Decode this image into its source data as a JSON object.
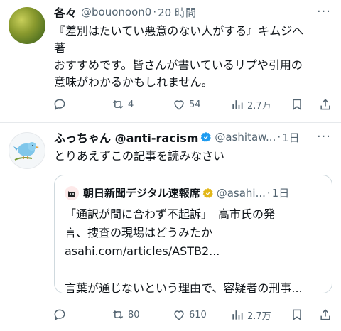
{
  "tweets": [
    {
      "name": "各々",
      "handle": "@bouonoon0",
      "dot": "·",
      "time": "20 時間",
      "body_lines": [
        "『差別はたいてい悪意のない人がする』キムジヘ",
        "著",
        "おすすめです。皆さんが書いているリプや引用の",
        "意味がわかるかもしれません。"
      ],
      "retweets": "4",
      "likes": "54",
      "views": "2.7万"
    },
    {
      "name": "ふっちゃん @anti-racism",
      "handle": "@ashitaw...",
      "dot": "·",
      "time": "1日",
      "body_lines": [
        "とりあえずこの記事を読みなさい"
      ],
      "quote": {
        "name": "朝日新聞デジタル速報席",
        "handle": "@asahi...",
        "dot": "·",
        "time": "1日",
        "lines": [
          "「通訳が間に合わず不起訴」　高市氏の発",
          "言、捜査の現場はどうみたか",
          "asahi.com/articles/ASTB2...",
          "",
          "言葉が通じないという理由で、容疑者の刑事..."
        ]
      },
      "retweets": "80",
      "likes": "610",
      "views": "2.7万"
    }
  ],
  "more_label": "···",
  "colors": {
    "verified": "#1d9bf0",
    "gold": "#e2b719",
    "muted": "#536471"
  },
  "icons": [
    "reply-icon",
    "retweet-icon",
    "like-icon",
    "views-icon",
    "bookmark-icon",
    "share-icon"
  ]
}
